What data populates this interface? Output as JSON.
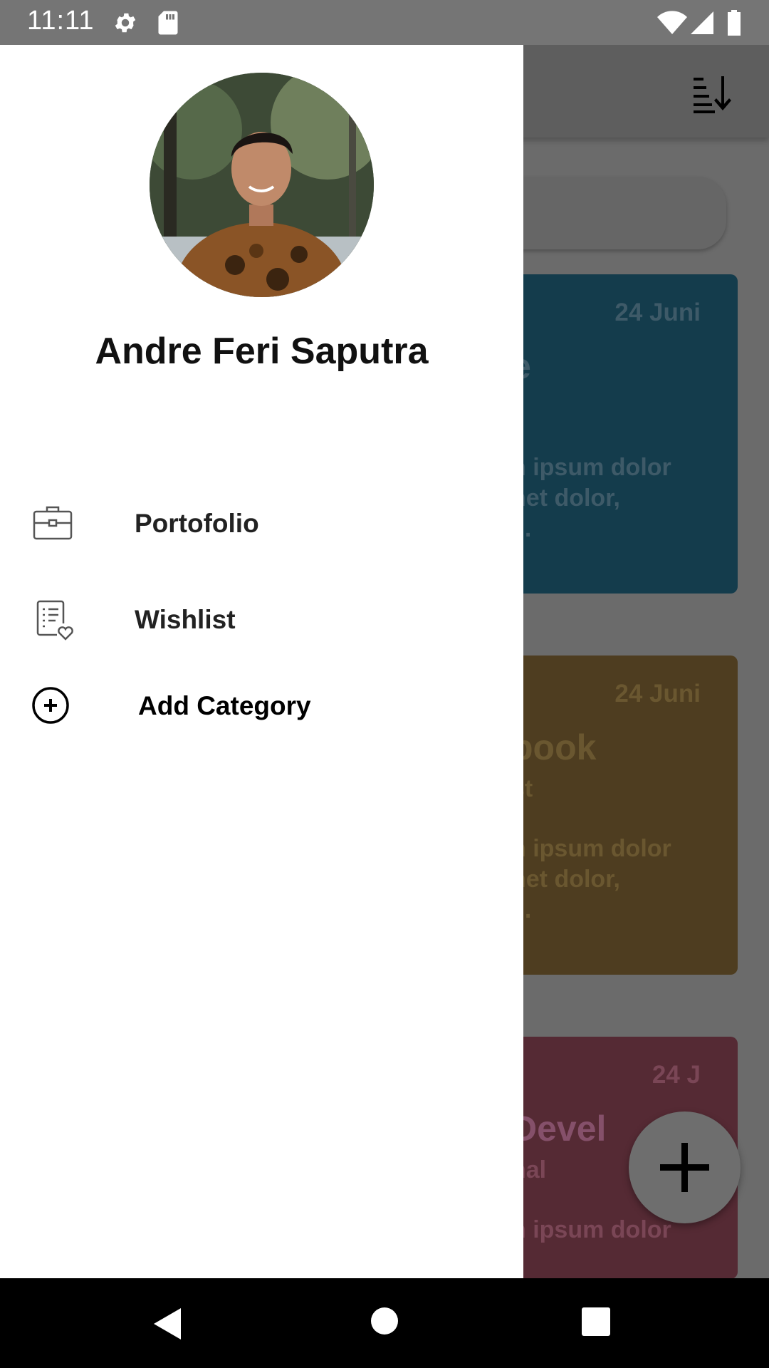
{
  "status_bar": {
    "time": "11:11",
    "icons": [
      "settings-icon",
      "sd-card-icon",
      "wifi-icon",
      "signal-icon",
      "battery-icon"
    ]
  },
  "drawer": {
    "profile_name": "Andre Feri Saputra",
    "menu_items": [
      {
        "label": "Portofolio",
        "icon": "briefcase-icon"
      },
      {
        "label": "Wishlist",
        "icon": "wishlist-icon"
      },
      {
        "label": "Add Category",
        "icon": "add-circle-icon"
      }
    ]
  },
  "background": {
    "appbar": {
      "icon": "sort-descending-icon"
    },
    "cards": [
      {
        "date": "24 Juni",
        "title_fragment": "e",
        "subtitle_fragment": "",
        "body_fragment": "n ipsum dolor\nnet dolor,\n..."
      },
      {
        "date": "24 Juni",
        "title_fragment": "book",
        "subtitle_fragment": "st",
        "body_fragment": "n ipsum dolor\nnet dolor,\n..."
      },
      {
        "date": "24 J",
        "title_fragment": "Devel",
        "subtitle_fragment": "nal",
        "body_fragment": "n ipsum dolor"
      }
    ],
    "fab_icon": "plus-icon"
  },
  "nav_bar": {
    "icons": [
      "back-icon",
      "home-icon",
      "recents-icon"
    ]
  },
  "colors": {
    "drawer": "#ffffff",
    "scrim": "#6b6b6b",
    "card_teal": "#143c4c",
    "card_brown": "#4e3d20",
    "card_maroon": "#552a34"
  }
}
